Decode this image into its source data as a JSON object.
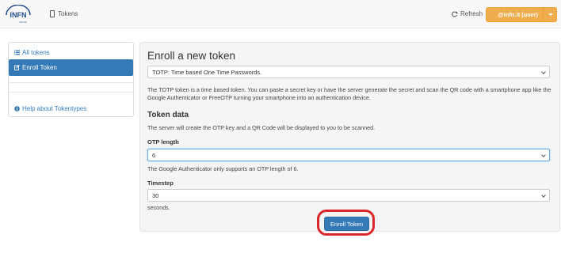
{
  "header": {
    "logo_text": "INFN",
    "logo_subtext": "ccr.cc",
    "nav_tokens": "Tokens",
    "refresh": "Refresh",
    "user": "@infn.it (user)"
  },
  "sidebar": {
    "items": [
      {
        "label": "All tokens"
      },
      {
        "label": "Enroll Token"
      },
      {
        "label": "Help about Tokentypes"
      }
    ]
  },
  "main": {
    "title": "Enroll a new token",
    "token_type": "TOTP: Time based One Time Passwords.",
    "description": "The TOTP token is a time based token. You can paste a secret key or have the server generate the secret and scan the QR code with a smartphone app like the Google Authenticator or FreeOTP turning your smartphone into an authentication device.",
    "token_data_heading": "Token data",
    "token_data_desc": "The server will create the OTP key and a QR Code will be displayed to you to be scanned.",
    "otp_length_label": "OTP length",
    "otp_length_value": "6",
    "otp_length_help": "The Google Authenticator only supports an OTP length of 6.",
    "timestep_label": "Timestep",
    "timestep_value": "30",
    "timestep_unit": "seconds.",
    "enroll_button": "Enroll Token"
  },
  "colors": {
    "primary": "#337ab7",
    "warning": "#f0ad4e",
    "highlight": "#d9262b"
  }
}
